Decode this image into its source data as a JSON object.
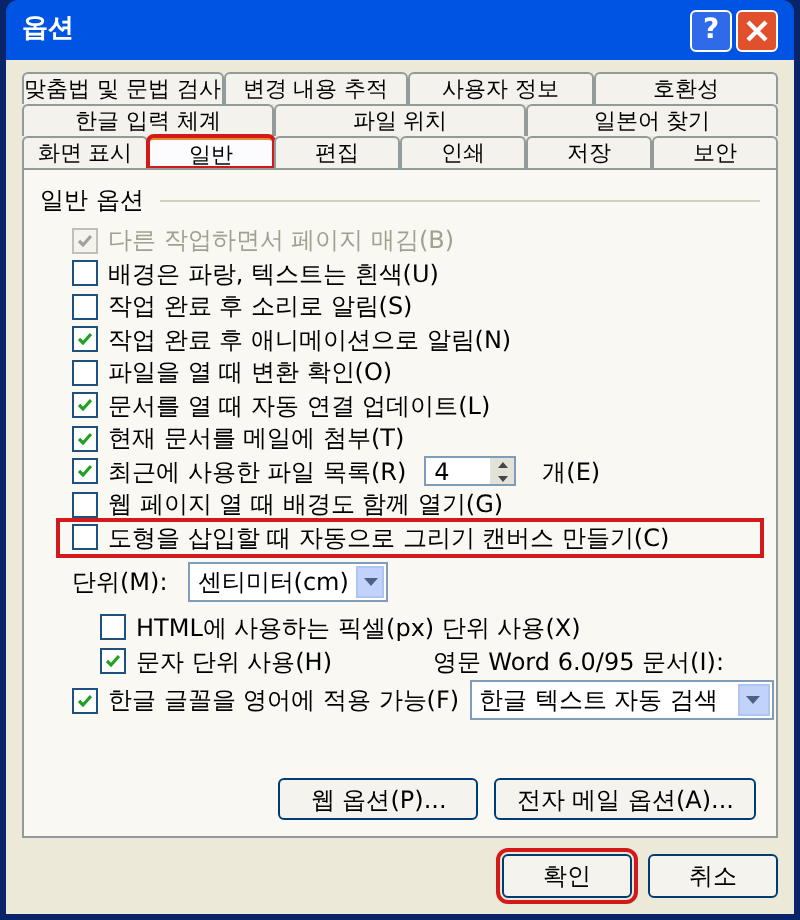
{
  "window": {
    "title": "옵션",
    "help": "?"
  },
  "tab_rows": [
    [
      {
        "label": "맞춤법 및 문법 검사",
        "selected": false,
        "highlighted": false
      },
      {
        "label": "변경 내용 추적",
        "selected": false,
        "highlighted": false
      },
      {
        "label": "사용자 정보",
        "selected": false,
        "highlighted": false
      },
      {
        "label": "호환성",
        "selected": false,
        "highlighted": false
      }
    ],
    [
      {
        "label": "한글 입력 체계",
        "selected": false,
        "highlighted": false
      },
      {
        "label": "파일 위치",
        "selected": false,
        "highlighted": false
      },
      {
        "label": "일본어 찾기",
        "selected": false,
        "highlighted": false
      }
    ],
    [
      {
        "label": "화면 표시",
        "selected": false,
        "highlighted": false
      },
      {
        "label": "일반",
        "selected": true,
        "highlighted": true
      },
      {
        "label": "편집",
        "selected": false,
        "highlighted": false
      },
      {
        "label": "인쇄",
        "selected": false,
        "highlighted": false
      },
      {
        "label": "저장",
        "selected": false,
        "highlighted": false
      },
      {
        "label": "보안",
        "selected": false,
        "highlighted": false
      }
    ]
  ],
  "general_options": {
    "title": "일반 옵션",
    "items": [
      {
        "kind": "checkbox",
        "label": "다른 작업하면서 페이지 매김(B)",
        "checked": true,
        "disabled": true,
        "highlighted": false
      },
      {
        "kind": "checkbox",
        "label": "배경은 파랑, 텍스트는 흰색(U)",
        "checked": false,
        "disabled": false,
        "highlighted": false
      },
      {
        "kind": "checkbox",
        "label": "작업 완료 후 소리로 알림(S)",
        "checked": false,
        "disabled": false,
        "highlighted": false
      },
      {
        "kind": "checkbox",
        "label": "작업 완료 후 애니메이션으로 알림(N)",
        "checked": true,
        "disabled": false,
        "highlighted": false
      },
      {
        "kind": "checkbox",
        "label": "파일을 열 때 변환 확인(O)",
        "checked": false,
        "disabled": false,
        "highlighted": false
      },
      {
        "kind": "checkbox",
        "label": "문서를 열 때 자동 연결 업데이트(L)",
        "checked": true,
        "disabled": false,
        "highlighted": false
      },
      {
        "kind": "checkbox",
        "label": "현재 문서를 메일에 첨부(T)",
        "checked": true,
        "disabled": false,
        "highlighted": false
      },
      {
        "kind": "spin",
        "label": "최근에 사용한 파일 목록(R)",
        "checked": true,
        "disabled": false,
        "highlighted": false,
        "value": "4",
        "suffix": "개(E)"
      },
      {
        "kind": "checkbox",
        "label": "웹 페이지 열 때 배경도 함께 열기(G)",
        "checked": false,
        "disabled": false,
        "highlighted": false
      },
      {
        "kind": "checkbox",
        "label": "도형을 삽입할 때 자동으로 그리기 캔버스 만들기(C)",
        "checked": false,
        "disabled": false,
        "highlighted": true
      }
    ]
  },
  "unit": {
    "label": "단위(M):",
    "value": "센티미터(cm)"
  },
  "unit_options": [
    {
      "label": "HTML에 사용하는 픽셀(px) 단위 사용(X)",
      "checked": false
    },
    {
      "label": "문자 단위 사용(H)",
      "checked": true
    }
  ],
  "hangul_font": {
    "label": "한글 글꼴을 영어에 적용 가능(F)",
    "checked": true
  },
  "word6": {
    "label": "영문 Word 6.0/95 문서(I):",
    "value": "한글 텍스트 자동 검색"
  },
  "panel_buttons": [
    "웹 옵션(P)...",
    "전자 메일 옵션(A)..."
  ],
  "dialog_buttons": [
    {
      "label": "확인",
      "highlighted": true
    },
    {
      "label": "취소",
      "highlighted": false
    }
  ]
}
